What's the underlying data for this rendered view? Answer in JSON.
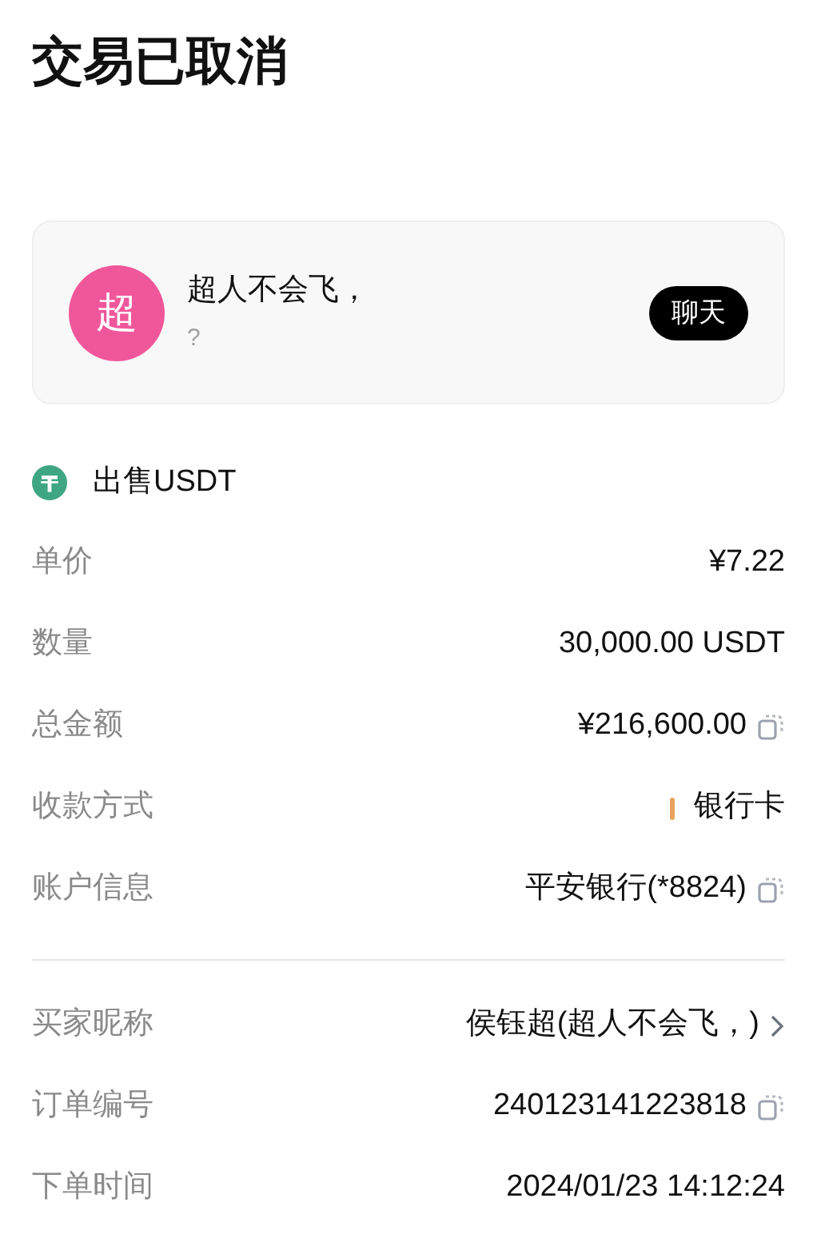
{
  "title": "交易已取消",
  "counterparty": {
    "avatar_text": "超",
    "name": "超人不会飞，",
    "subtitle": "?",
    "chat_button": "聊天"
  },
  "asset": {
    "label": "出售USDT"
  },
  "details": [
    {
      "kind": "plain",
      "label": "单价",
      "value": "¥7.22"
    },
    {
      "kind": "plain",
      "label": "数量",
      "value": "30,000.00 USDT"
    },
    {
      "kind": "copy",
      "label": "总金额",
      "value": "¥216,600.00"
    },
    {
      "kind": "payment",
      "label": "收款方式",
      "value": "银行卡",
      "color": "#e8a15c"
    },
    {
      "kind": "copy",
      "label": "账户信息",
      "value": "平安银行(*8824)"
    }
  ],
  "order_details": [
    {
      "kind": "link",
      "label": "买家昵称",
      "value": "侯钰超(超人不会飞，)"
    },
    {
      "kind": "copy",
      "label": "订单编号",
      "value": "240123141223818"
    },
    {
      "kind": "plain",
      "label": "下单时间",
      "value": "2024/01/23 14:12:24"
    }
  ]
}
